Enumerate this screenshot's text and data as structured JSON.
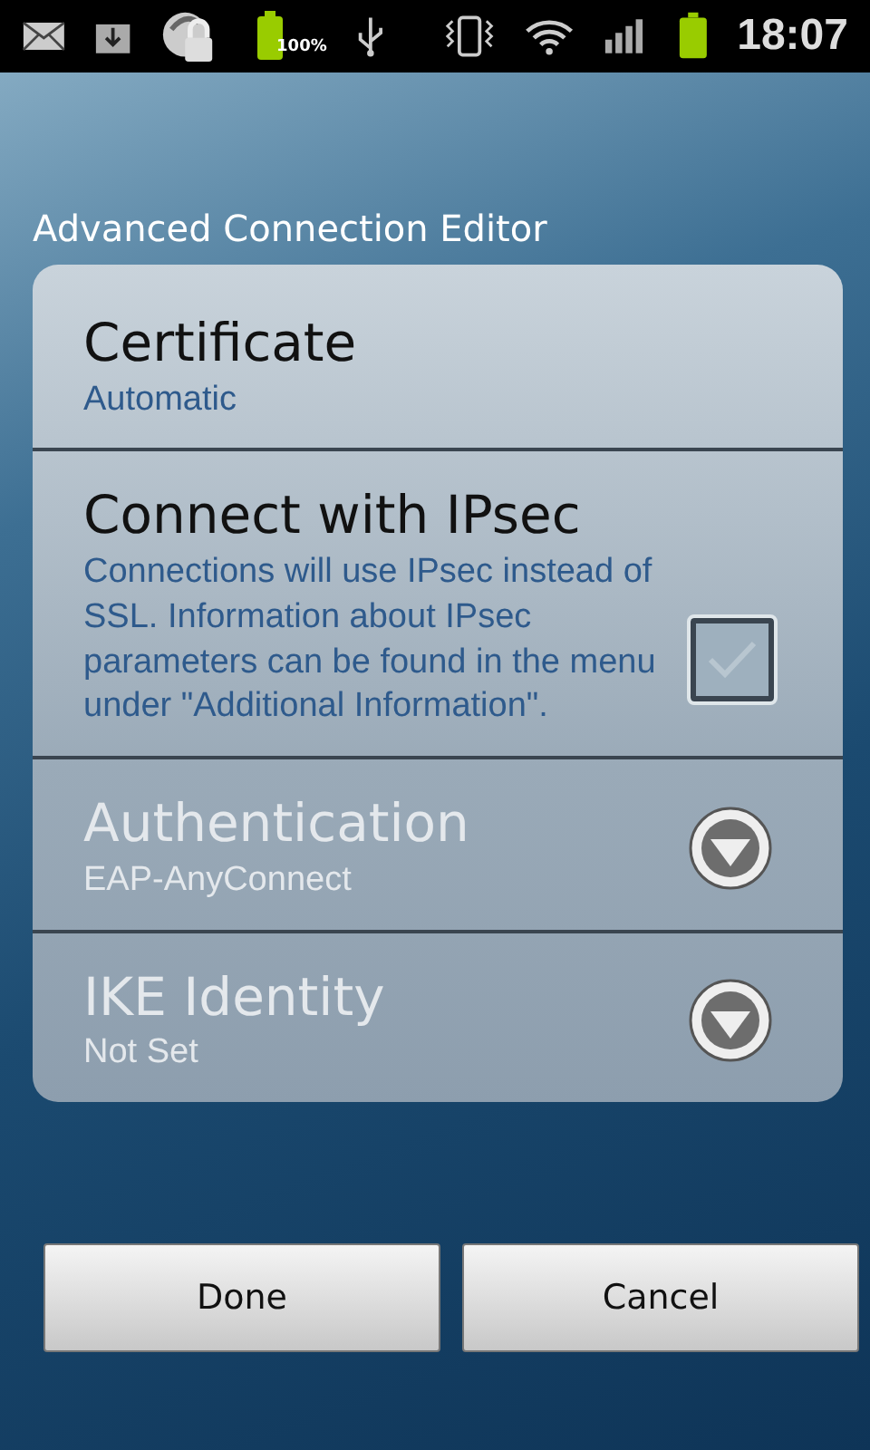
{
  "status_bar": {
    "battery_label": "100%",
    "time": "18:07"
  },
  "title": "Advanced Connection Editor",
  "settings": [
    {
      "kind": "text",
      "title": "Certificate",
      "summary": "Automatic",
      "disabled": false
    },
    {
      "kind": "checkbox",
      "title": "Connect with IPsec",
      "summary": "Connections will use IPsec instead of SSL. Information about IPsec parameters can be found in the menu under \"Additional Information\".",
      "checked": false,
      "disabled": false
    },
    {
      "kind": "dropdown",
      "title": "Authentication",
      "summary": "EAP-AnyConnect",
      "disabled": true
    },
    {
      "kind": "dropdown",
      "title": "IKE Identity",
      "summary": "Not Set",
      "disabled": true
    }
  ],
  "buttons": [
    "Done",
    "Cancel"
  ]
}
